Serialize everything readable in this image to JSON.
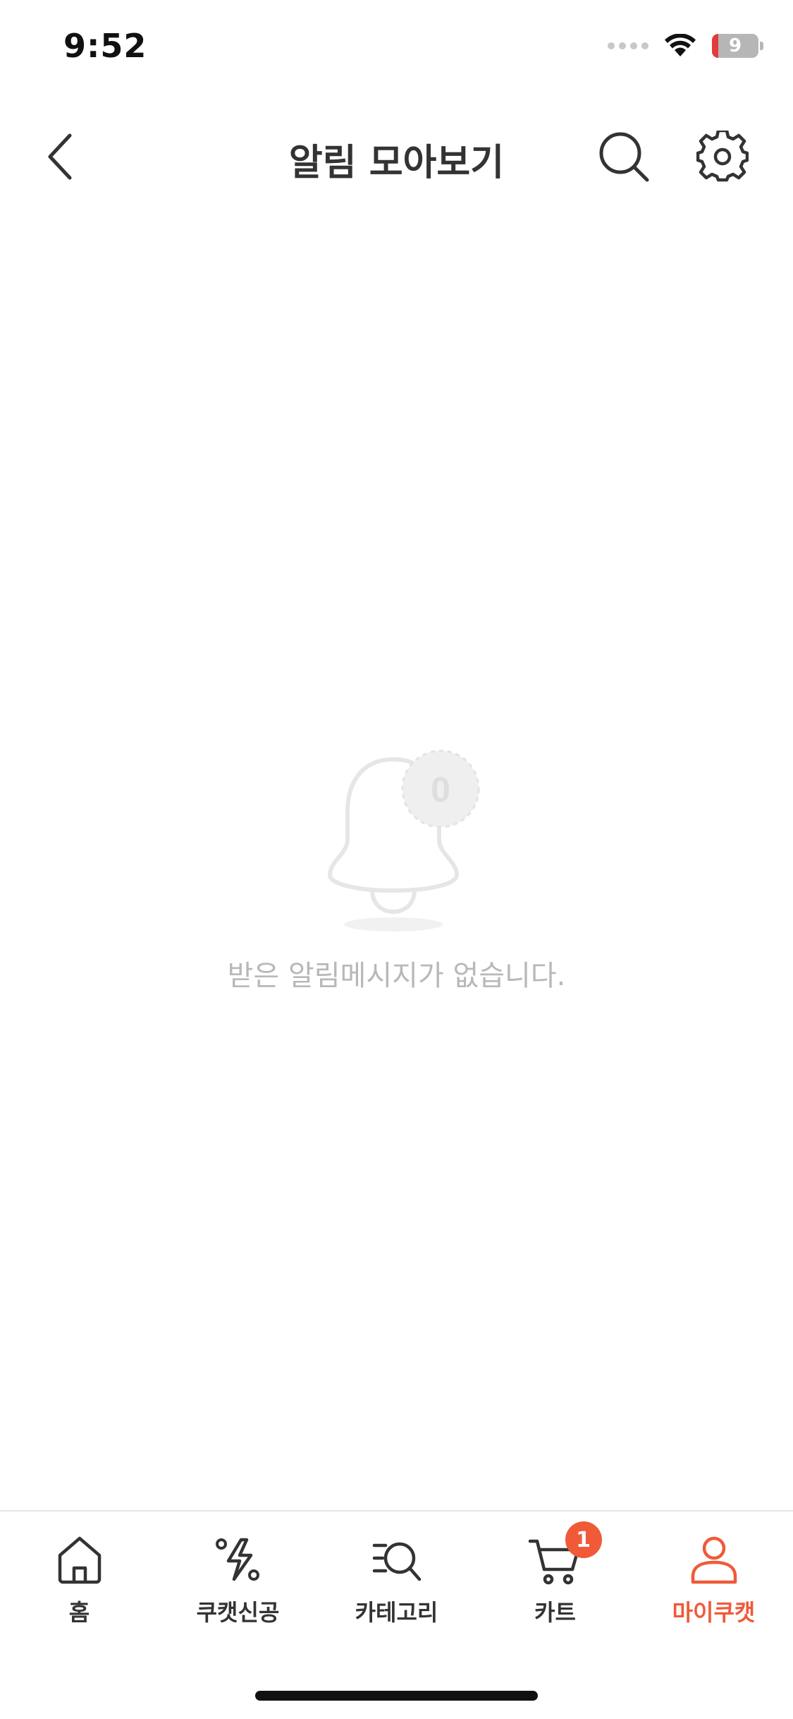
{
  "status_bar": {
    "time": "9:52",
    "battery_level": "9"
  },
  "header": {
    "title": "알림 모아보기",
    "back_icon": "chevron-left-icon",
    "search_icon": "search-icon",
    "settings_icon": "gear-icon"
  },
  "empty_state": {
    "illustration_icon": "bell-icon",
    "badge_count": "0",
    "message": "받은 알림메시지가 없습니다."
  },
  "bottom_nav": {
    "items": [
      {
        "label": "홈",
        "icon": "home-icon"
      },
      {
        "label": "쿠캣신공",
        "icon": "lightning-percent-icon"
      },
      {
        "label": "카테고리",
        "icon": "category-search-icon"
      },
      {
        "label": "카트",
        "icon": "cart-icon",
        "badge": "1"
      },
      {
        "label": "마이쿠캣",
        "icon": "person-icon",
        "active": true
      }
    ]
  },
  "colors": {
    "accent": "#f05a38",
    "text_dark": "#333333",
    "text_muted": "#b8b8b8"
  }
}
